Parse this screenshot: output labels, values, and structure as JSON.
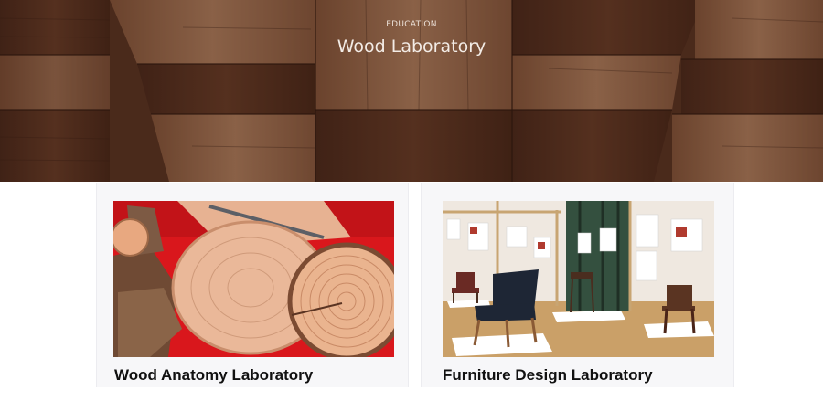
{
  "hero": {
    "eyebrow": "EDUCATION",
    "title": "Wood Laboratory",
    "image": "wood-blocks-texture"
  },
  "cards": [
    {
      "title": "Wood Anatomy Laboratory",
      "image": "wood-cross-sections-photo"
    },
    {
      "title": "Furniture Design Laboratory",
      "image": "chair-exhibition-photo"
    }
  ],
  "colors": {
    "hero_wood_dark": "#5a3422",
    "hero_wood_light": "#c99a76",
    "card_bg": "#f7f7f9",
    "title_text": "#111111"
  }
}
